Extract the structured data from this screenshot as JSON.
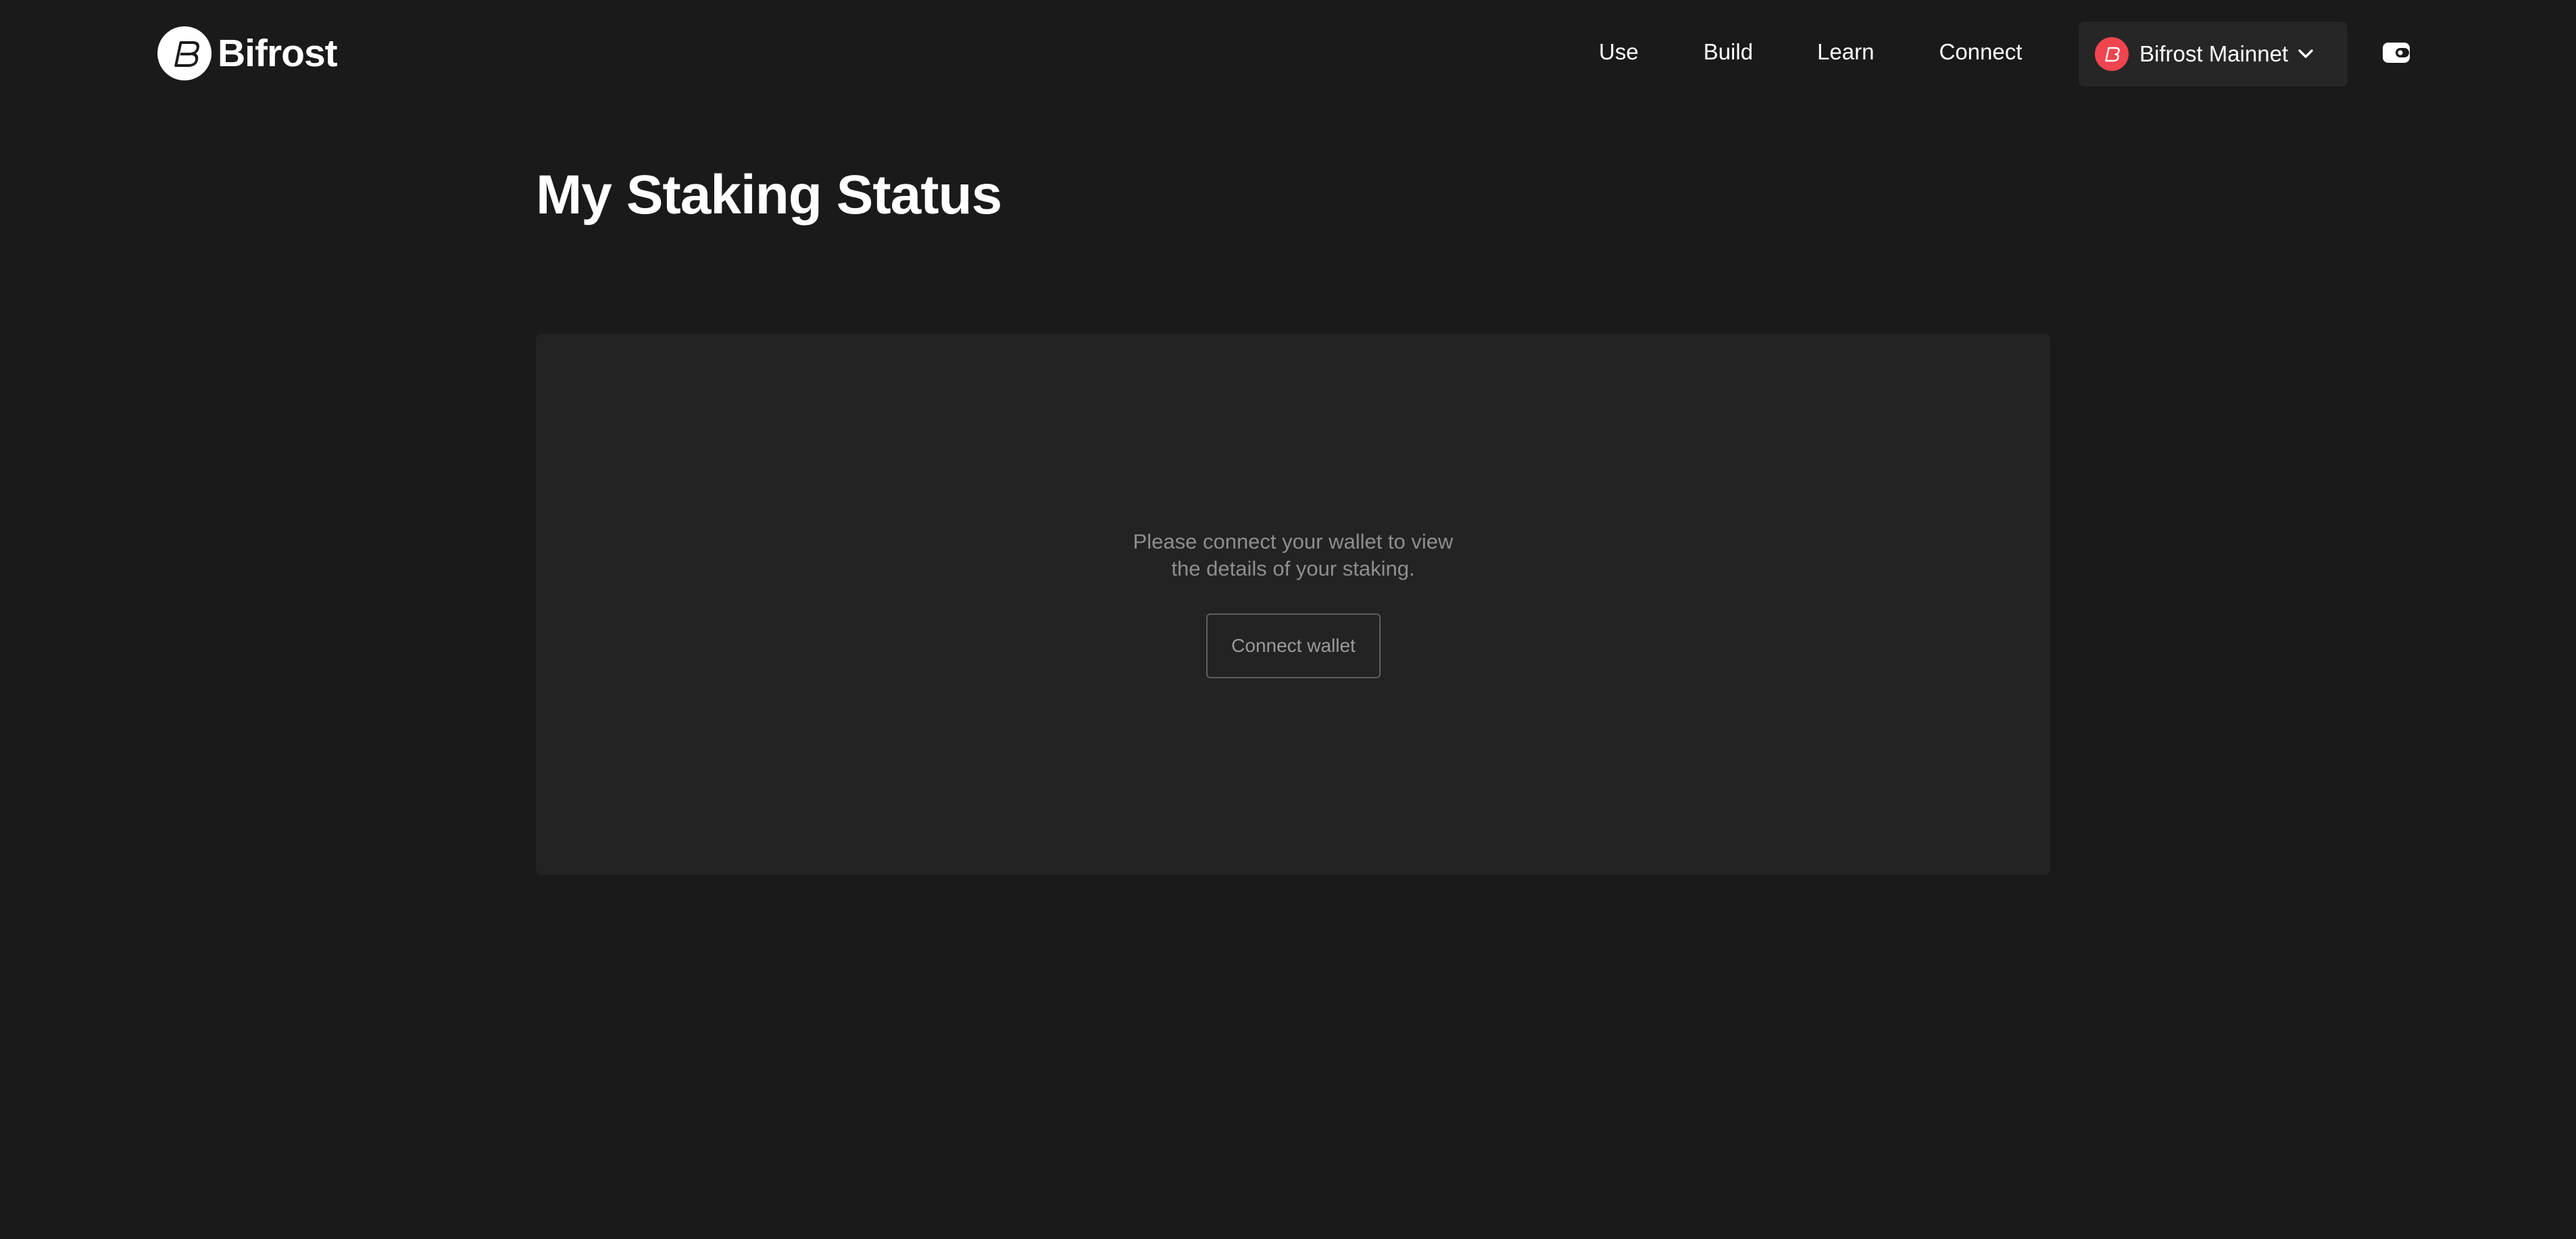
{
  "brand": {
    "name": "Bifrost",
    "logo_icon": "bifrost-logo-icon"
  },
  "nav": {
    "items": [
      {
        "label": "Use"
      },
      {
        "label": "Build"
      },
      {
        "label": "Learn"
      },
      {
        "label": "Connect"
      }
    ]
  },
  "network": {
    "selected": "Bifrost Mainnet",
    "icon": "bifrost-network-icon",
    "accent_color": "#f0454f",
    "dropdown_icon": "chevron-down-icon"
  },
  "wallet_button": {
    "icon": "wallet-icon"
  },
  "page": {
    "title": "My Staking Status"
  },
  "status_card": {
    "message_line1": "Please connect your wallet to view",
    "message_line2": "the details of your staking.",
    "button_label": "Connect wallet"
  },
  "colors": {
    "background": "#1a1a1a",
    "card": "#232323",
    "select_bg": "#262626",
    "text_primary": "#ffffff",
    "text_muted": "#8e8e8e"
  }
}
